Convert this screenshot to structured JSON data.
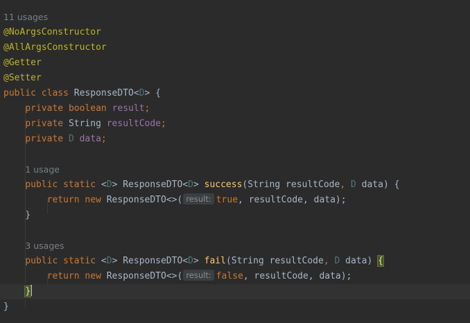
{
  "usages_class": "11 usages",
  "annotations": [
    "@NoArgsConstructor",
    "@AllArgsConstructor",
    "@Getter",
    "@Setter"
  ],
  "class_decl": {
    "kw1": "public",
    "kw2": "class",
    "name": "ResponseDTO",
    "lt": "<",
    "tparam": "D",
    "gt": ">",
    "open": " {"
  },
  "fields": [
    {
      "mod": "private",
      "type": "boolean",
      "name": "result"
    },
    {
      "mod": "private",
      "type": "String",
      "name": "resultCode"
    },
    {
      "mod": "private",
      "type": "D",
      "name": "data"
    }
  ],
  "method_success": {
    "usages": "1 usage",
    "kw1": "public",
    "kw2": "static",
    "tparam": "D",
    "ret": "ResponseDTO",
    "name": "success",
    "p1type": "String",
    "p1name": "resultCode",
    "p2type": "D",
    "p2name": "data",
    "ret_kw": "return",
    "new_kw": "new",
    "ctor": "ResponseDTO<>(",
    "hint": "result:",
    "arg1": "true",
    "rest": ", resultCode, data);",
    "close": "}"
  },
  "method_fail": {
    "usages": "3 usages",
    "kw1": "public",
    "kw2": "static",
    "tparam": "D",
    "ret": "ResponseDTO",
    "name": "fail",
    "p1type": "String",
    "p1name": "resultCode",
    "p2type": "D",
    "p2name": "data",
    "ret_kw": "return",
    "new_kw": "new",
    "ctor": "ResponseDTO<>(",
    "hint": "result:",
    "arg1": "false",
    "rest": ", resultCode, data);",
    "close": "}"
  },
  "class_close": "}"
}
